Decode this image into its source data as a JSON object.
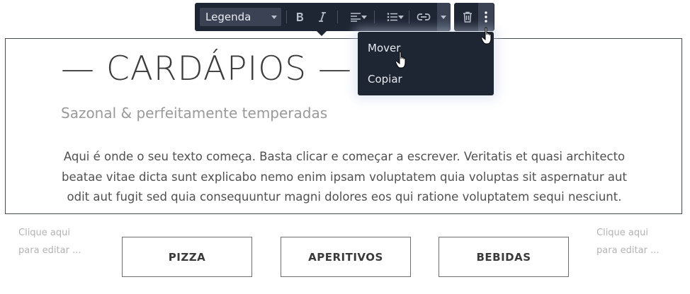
{
  "section": {
    "title": "— CARDÁPIOS —",
    "subtitle": "Sazonal & perfeitamente temperadas",
    "body_lines": [
      "Aqui é onde o seu texto começa. Basta clicar e começar a escrever. Veritatis et quasi architecto",
      "beatae vitae dicta sunt explicabo nemo enim ipsam voluptatem quia voluptas sit aspernatur aut",
      "odit aut fugit sed quia consequuntur magni dolores eos qui ratione voluptatem sequi nesciunt."
    ]
  },
  "placeholders": {
    "left": [
      "Clique aqui",
      "para editar ..."
    ],
    "right": [
      "Clique aqui",
      "para editar ..."
    ]
  },
  "menu_buttons": [
    "PIZZA",
    "APERITIVOS",
    "BEBIDAS"
  ],
  "toolbar": {
    "font_style": "Legenda",
    "icons": [
      "bold-icon",
      "italic-icon",
      "align-left-icon",
      "list-icon",
      "link-icon",
      "chevron-down-icon",
      "trash-icon",
      "more-vertical-icon"
    ]
  },
  "context_menu": {
    "items": [
      "Mover",
      "Copiar"
    ]
  },
  "colors": {
    "toolbar_bg": "#1e2533",
    "toolbar_active": "#3a4254",
    "border": "#444a52"
  }
}
